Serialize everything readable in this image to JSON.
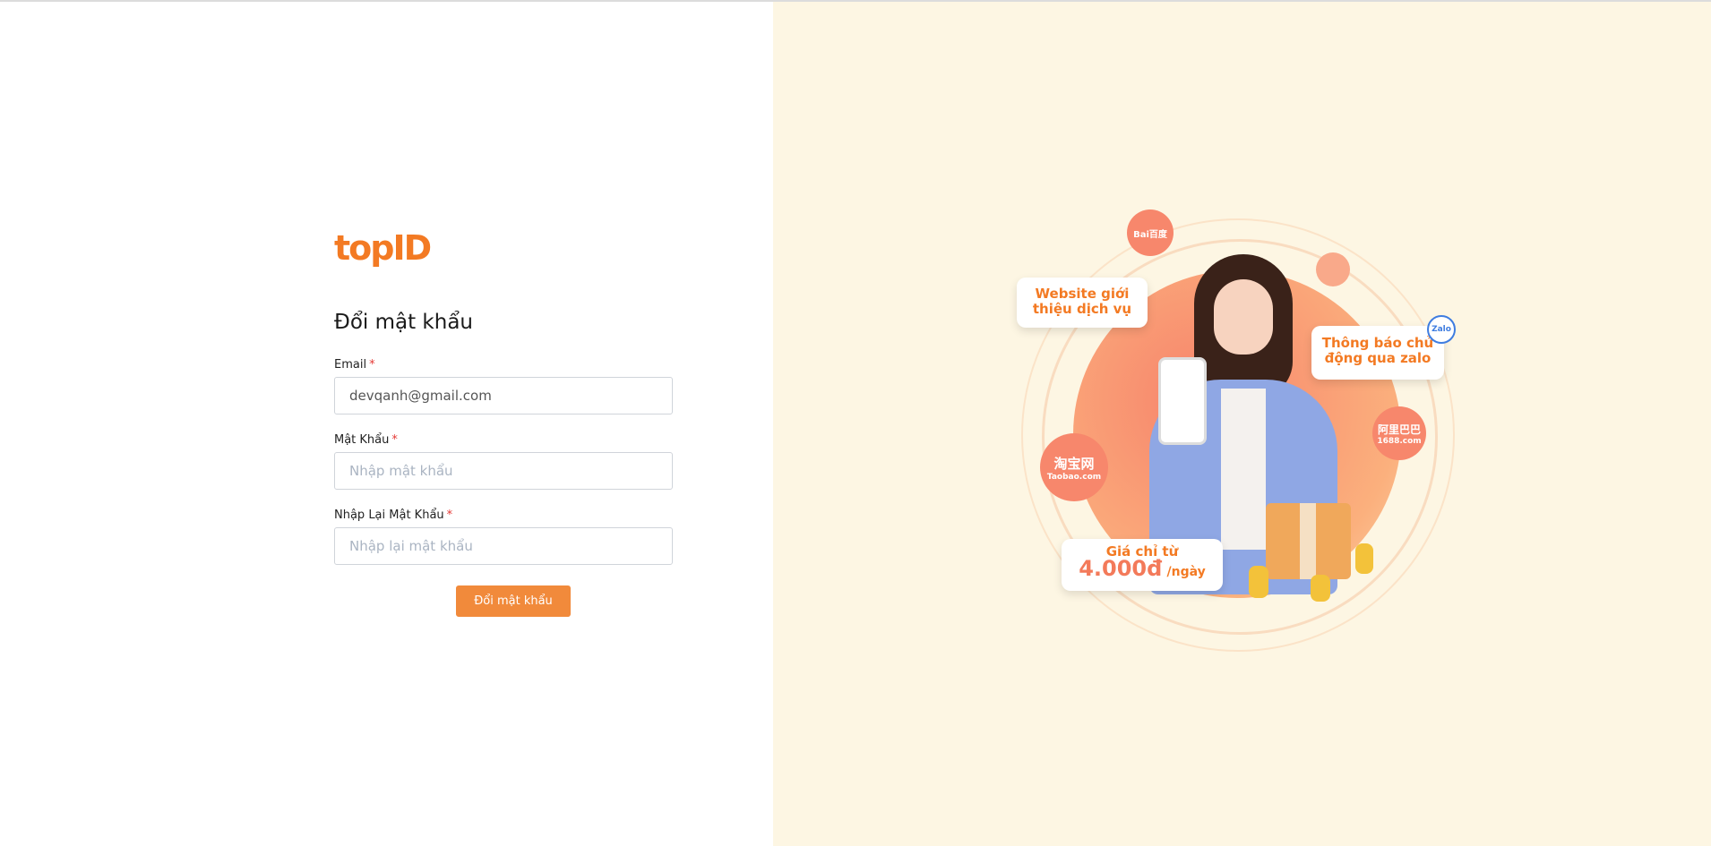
{
  "brand": {
    "logo_text": "topID"
  },
  "form": {
    "title": "Đổi mật khẩu",
    "email_label": "Email",
    "email_value": "devqanh@gmail.com",
    "password_label": "Mật Khẩu",
    "password_placeholder": "Nhập mật khẩu",
    "confirm_label": "Nhập Lại Mật Khẩu",
    "confirm_placeholder": "Nhập lại mật khẩu",
    "required_mark": "*",
    "submit_label": "Đổi mật khẩu"
  },
  "promo": {
    "bubble_website": "Website giới thiệu dịch vụ",
    "bubble_zalo": "Thông báo chủ động qua zalo",
    "price_caption": "Giá chỉ từ",
    "price_value": "4.000đ",
    "price_unit": "/ngày",
    "badge_baidu": "Bai百度",
    "badge_zalo": "Zalo",
    "badge_taobao_main": "淘宝网",
    "badge_taobao_sub": "Taobao.com",
    "badge_1688_main": "阿里巴巴",
    "badge_1688_sub": "1688.com"
  },
  "colors": {
    "accent": "#f37a23",
    "button": "#f18a3b",
    "panel_bg": "#fdf6e3"
  }
}
